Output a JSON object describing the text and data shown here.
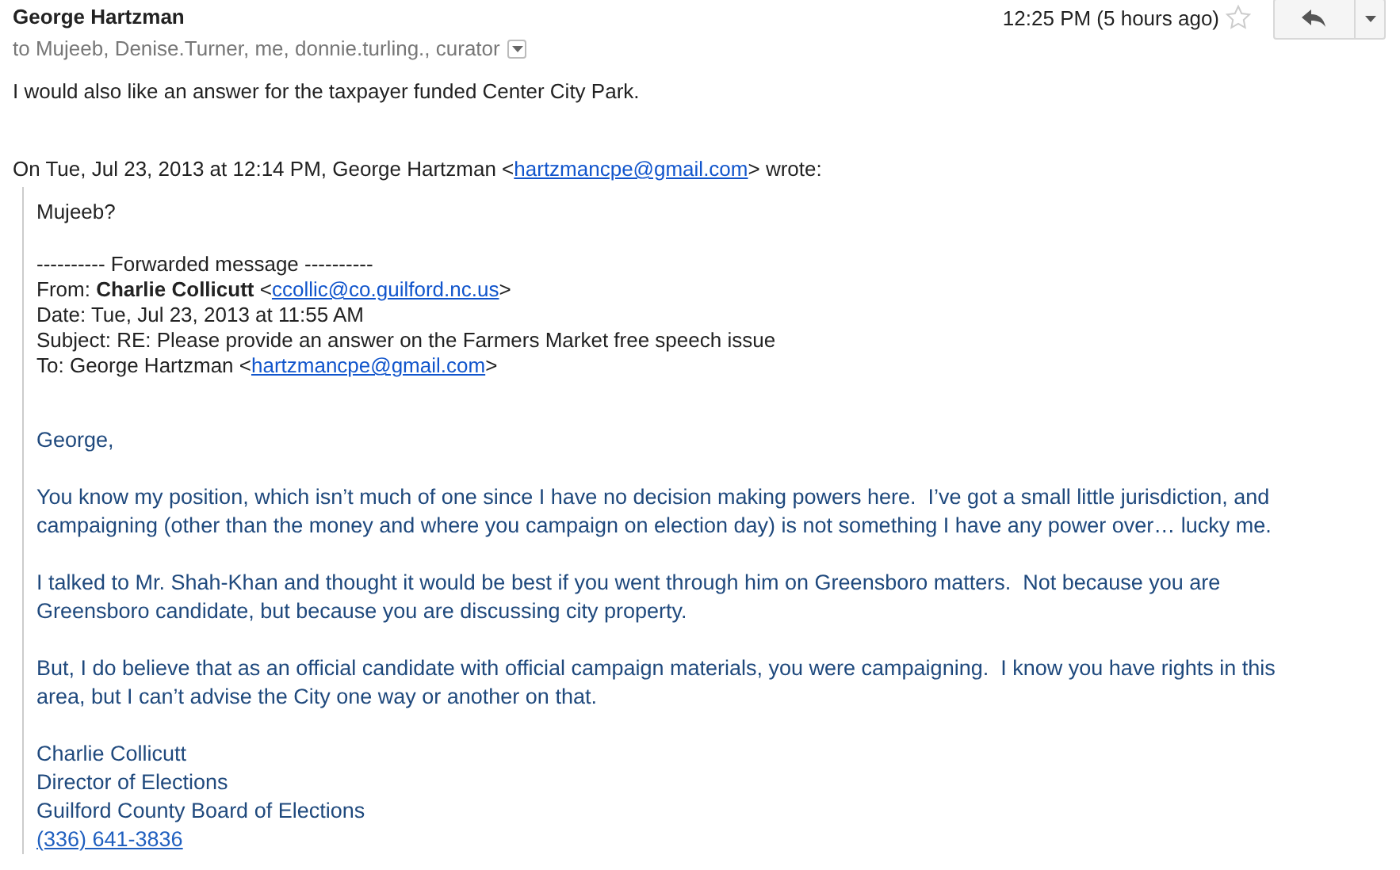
{
  "header": {
    "sender": "George Hartzman",
    "recipients": "to Mujeeb, Denise.Turner, me, donnie.turling., curator",
    "time": "12:25 PM (5 hours ago)",
    "starred": false
  },
  "body": "I would also like an answer for the taxpayer funded Center City Park.",
  "attribution": [
    {
      "kind": "text",
      "text": "On Tue, Jul 23, 2013 at 12:14 PM, George Hartzman <"
    },
    {
      "kind": "link",
      "text": "hartzmancpe@gmail.com"
    },
    {
      "kind": "text",
      "text": "> wrote:"
    }
  ],
  "quote": {
    "greeting": "Mujeeb?",
    "forward_lines": [
      [
        {
          "kind": "text",
          "text": "---------- Forwarded message ----------"
        }
      ],
      [
        {
          "kind": "text",
          "text": "From: **Charlie Collicutt** <"
        },
        {
          "kind": "link",
          "text": "ccollic@co.guilford.nc.us"
        },
        {
          "kind": "text",
          "text": ">"
        }
      ],
      [
        {
          "kind": "text",
          "text": "Date: Tue, Jul 23, 2013 at 11:55 AM"
        }
      ],
      [
        {
          "kind": "text",
          "text": "Subject: RE: Please provide an answer on the Farmers Market free speech issue"
        }
      ],
      [
        {
          "kind": "text",
          "text": "To: George Hartzman <"
        },
        {
          "kind": "link",
          "text": "hartzmancpe@gmail.com"
        },
        {
          "kind": "text",
          "text": ">"
        }
      ]
    ],
    "paragraphs": [
      "George,",
      "You know my position, which isn’t much of one since I have no decision making powers here.  I’ve got a small little jurisdiction, and campaigning (other than the money and where you campaign on election day) is not something I have any power over… lucky me.",
      "I talked to Mr. Shah-Khan and thought it would be best if you went through him on Greensboro matters.  Not because you are Greensboro candidate, but because you are discussing city property.",
      "But, I do believe that as an official candidate with official campaign materials, you were campaigning.  I know you have rights in this area, but I can’t advise the City one way or another on that."
    ],
    "signature": [
      {
        "kind": "text",
        "text": "Charlie Collicutt"
      },
      {
        "kind": "text",
        "text": "Director of Elections"
      },
      {
        "kind": "text",
        "text": "Guilford County Board of Elections"
      },
      {
        "kind": "link",
        "text": "(336) 641-3836"
      }
    ]
  }
}
